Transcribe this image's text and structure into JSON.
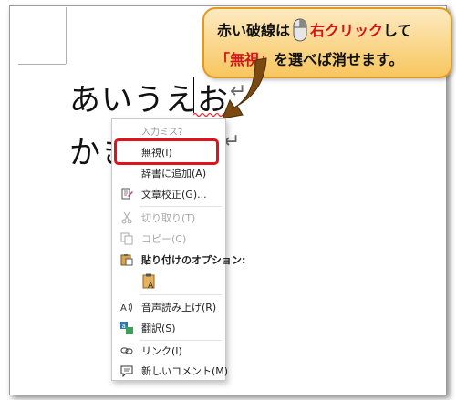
{
  "document": {
    "line1": "あいうえお",
    "line2": "かき",
    "paragraph_mark": "↵"
  },
  "callout": {
    "line1_part1": "赤い破線は",
    "line1_part2": "右クリック",
    "line1_part3": "して",
    "line2_part1": "「無視」",
    "line2_part2": "を選べば消せます。",
    "accent_color": "#d8121b",
    "background_color": "#f7c65f"
  },
  "context_menu": {
    "header": "入力ミス?",
    "items": [
      {
        "label": "無視(I)",
        "icon": "none",
        "highlighted": true
      },
      {
        "label": "辞書に追加(A)",
        "icon": "none"
      },
      {
        "label": "文章校正(G)...",
        "icon": "proofing-icon"
      },
      {
        "label": "切り取り(T)",
        "icon": "scissors-icon",
        "disabled": true
      },
      {
        "label": "コピー(C)",
        "icon": "copy-icon",
        "disabled": true
      },
      {
        "label": "貼り付けのオプション:",
        "icon": "paste-icon"
      },
      {
        "label": "音声読み上げ(R)",
        "icon": "read-aloud-icon"
      },
      {
        "label": "翻訳(S)",
        "icon": "translate-icon"
      },
      {
        "label": "リンク(I)",
        "icon": "link-icon"
      },
      {
        "label": "新しいコメント(M)",
        "icon": "comment-icon"
      }
    ]
  },
  "highlight_color": "#e0121b"
}
